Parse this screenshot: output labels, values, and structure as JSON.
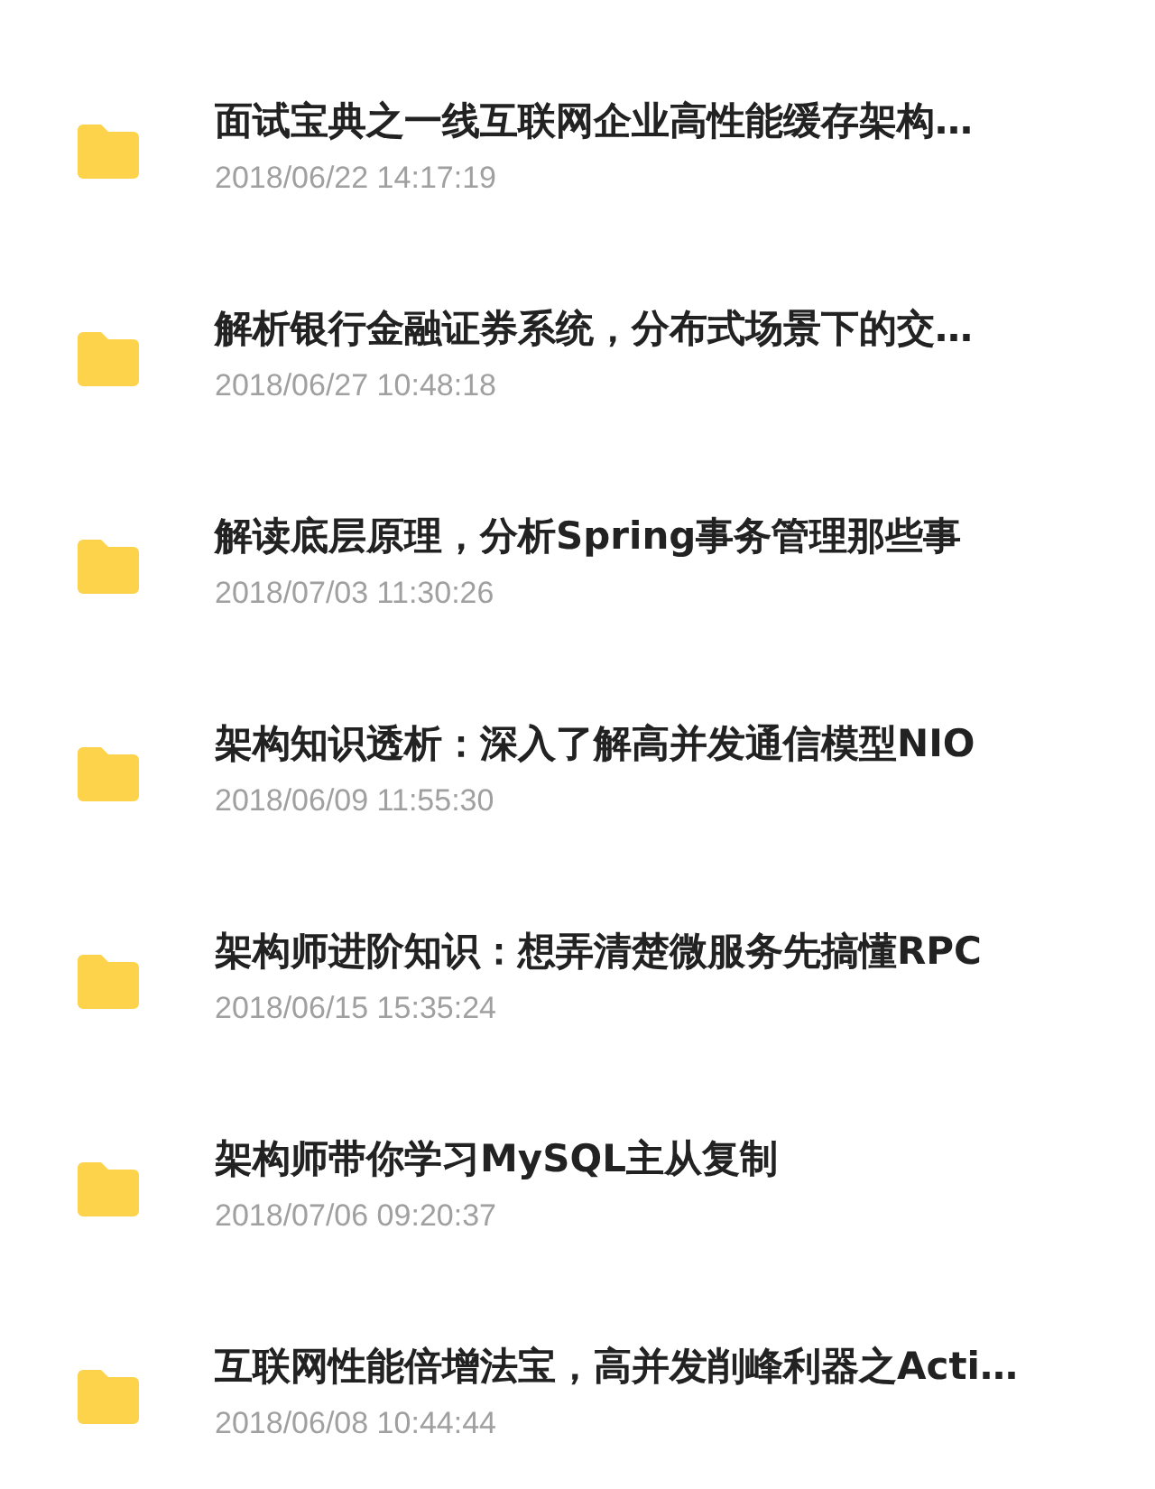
{
  "files": [
    {
      "name": "面试宝典之一线互联网企业高性能缓存架构…",
      "date": "2018/06/22 14:17:19"
    },
    {
      "name": "解析银行金融证券系统，分布式场景下的交…",
      "date": "2018/06/27 10:48:18"
    },
    {
      "name": "解读底层原理，分析Spring事务管理那些事",
      "date": "2018/07/03 11:30:26"
    },
    {
      "name": "架构知识透析：深入了解高并发通信模型NIO",
      "date": "2018/06/09 11:55:30"
    },
    {
      "name": "架构师进阶知识：想弄清楚微服务先搞懂RPC",
      "date": "2018/06/15 15:35:24"
    },
    {
      "name": "架构师带你学习MySQL主从复制",
      "date": "2018/07/06 09:20:37"
    },
    {
      "name": "互联网性能倍增法宝，高并发削峰利器之Acti…",
      "date": "2018/06/08 10:44:44"
    }
  ]
}
